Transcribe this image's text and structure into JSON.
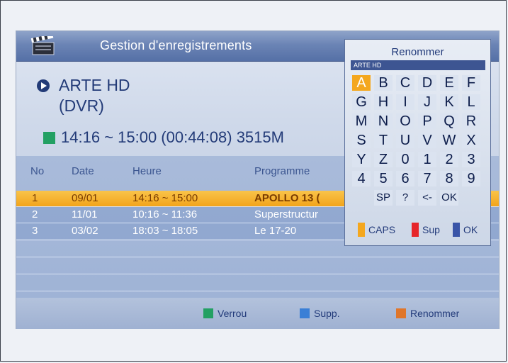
{
  "title": "Gestion d'enregistrements",
  "channel": {
    "name": "ARTE HD",
    "type": "(DVR)"
  },
  "recording": {
    "line": "14:16 ~ 15:00 (00:44:08) 3515M"
  },
  "list": {
    "headers": {
      "no": "No",
      "date": "Date",
      "heure": "Heure",
      "programme": "Programme"
    },
    "rows": [
      {
        "no": "1",
        "date": "09/01",
        "time": "14:16 ~ 15:00",
        "programme": "APOLLO 13 ("
      },
      {
        "no": "2",
        "date": "11/01",
        "time": "10:16 ~ 11:36",
        "programme": "Superstructur"
      },
      {
        "no": "3",
        "date": "03/02",
        "time": "18:03 ~ 18:05",
        "programme": "Le 17-20"
      }
    ]
  },
  "footer": {
    "lock": "Verrou",
    "delete": "Supp.",
    "rename": "Renommer"
  },
  "keyboard": {
    "title": "Renommer",
    "field_value": "ARTE HD",
    "rows": [
      [
        "A",
        "B",
        "C",
        "D",
        "E",
        "F"
      ],
      [
        "G",
        "H",
        "I",
        "J",
        "K",
        "L"
      ],
      [
        "M",
        "N",
        "O",
        "P",
        "Q",
        "R"
      ],
      [
        "S",
        "T",
        "U",
        "V",
        "W",
        "X"
      ],
      [
        "Y",
        "Z",
        "0",
        "1",
        "2",
        "3"
      ],
      [
        "4",
        "5",
        "6",
        "7",
        "8",
        "9"
      ]
    ],
    "specials": [
      "SP",
      "?",
      "<-",
      "OK"
    ],
    "legend": {
      "caps": "CAPS",
      "sup": "Sup",
      "ok": "OK"
    }
  },
  "colors": {
    "yellow": "#f4a71e",
    "red": "#e6252a",
    "blue": "#3a55a8",
    "green": "#23a063"
  }
}
